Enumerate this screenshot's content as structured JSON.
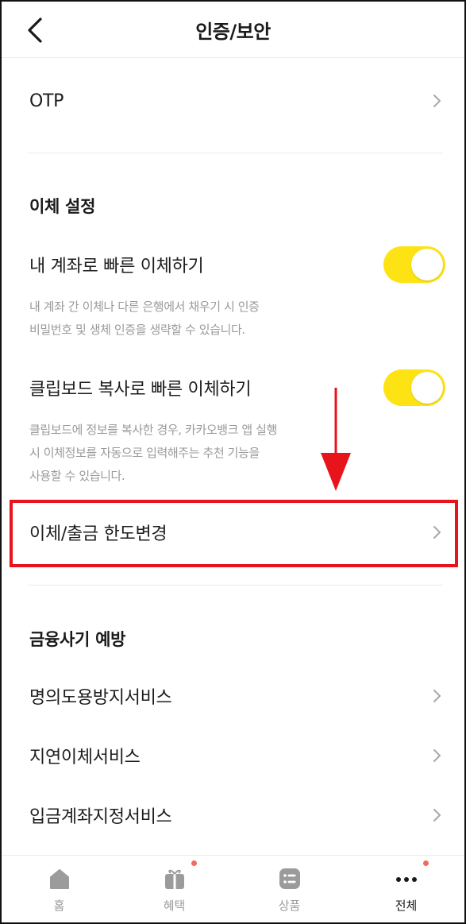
{
  "header": {
    "title": "인증/보안"
  },
  "otp": {
    "label": "OTP"
  },
  "transfer_settings": {
    "section_title": "이체 설정",
    "quick_own_account": {
      "label": "내 계좌로 빠른 이체하기",
      "enabled": true,
      "description_line1": "내 계좌 간 이체나 다른 은행에서 채우기 시 인증",
      "description_line2": "비밀번호 및 생체 인증을 생략할 수 있습니다."
    },
    "clipboard_transfer": {
      "label": "클립보드 복사로 빠른 이체하기",
      "enabled": true,
      "description_line1": "클립보드에 정보를 복사한 경우, 카카오뱅크 앱 실행",
      "description_line2": "시 이체정보를 자동으로 입력해주는 추천 기능을",
      "description_line3": "사용할 수 있습니다."
    },
    "limit_change": {
      "label": "이체/출금 한도변경"
    }
  },
  "fraud_prevention": {
    "section_title": "금융사기 예방",
    "items": [
      {
        "label": "명의도용방지서비스"
      },
      {
        "label": "지연이체서비스"
      },
      {
        "label": "입금계좌지정서비스"
      }
    ]
  },
  "tabbar": {
    "tabs": [
      {
        "label": "홈",
        "icon": "home-icon"
      },
      {
        "label": "혜택",
        "icon": "gift-icon",
        "badge": true
      },
      {
        "label": "상품",
        "icon": "list-icon"
      },
      {
        "label": "전체",
        "icon": "more-icon",
        "badge": true,
        "active": true
      }
    ]
  },
  "colors": {
    "toggle_on": "#fde314",
    "highlight": "#e8141c",
    "badge": "#f06a5e",
    "muted_text": "#9a9a9a"
  }
}
